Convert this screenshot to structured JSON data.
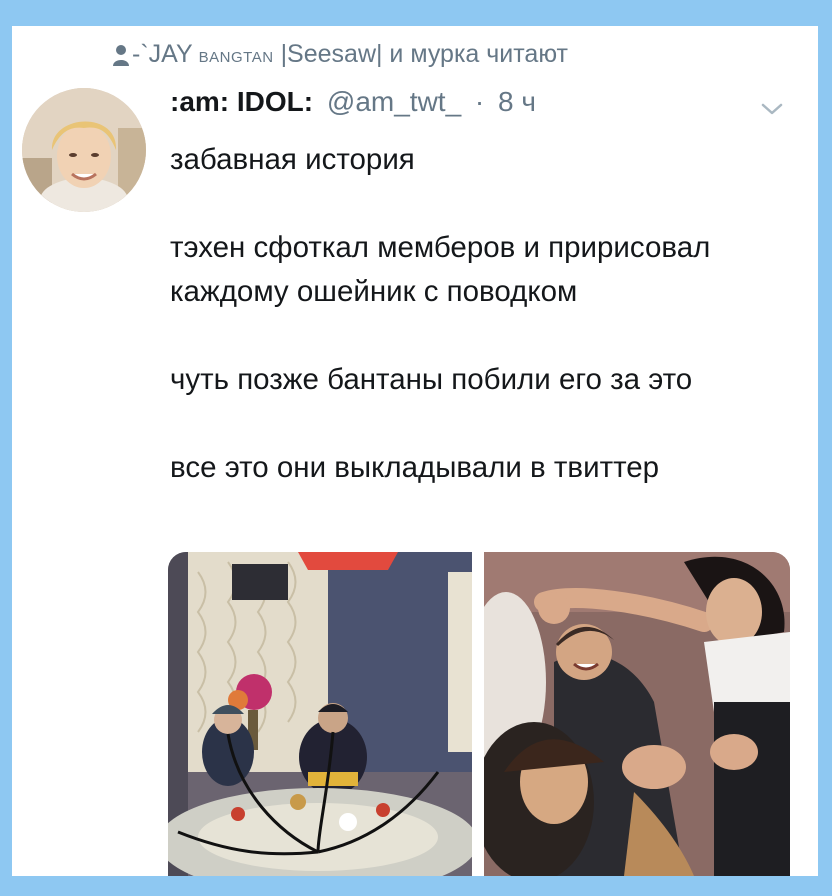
{
  "social_context": {
    "icon": "person-icon",
    "prefix": "-`JAY",
    "small_caps": "BANGTAN",
    "rest": "|Seesaw| и мурка читают"
  },
  "tweet": {
    "display_name": ":am: IDOL:",
    "handle": "@am_twt_",
    "separator": "·",
    "time": "8 ч",
    "paragraphs": [
      "забавная история",
      "тэхен сфоткал мемберов и пририсовал каждому ошейник с поводком",
      "чуть позже бантаны побили его за это",
      "все это они выкладывали в твиттер"
    ],
    "avatar_icon": "avatar-photo",
    "menu_icon": "chevron-down-icon",
    "media": [
      {
        "name": "photo-group-dinner"
      },
      {
        "name": "photo-members-fighting"
      }
    ]
  },
  "colors": {
    "background": "#8ec8f2",
    "card": "#ffffff",
    "text": "#14171a",
    "secondary": "#657786"
  }
}
